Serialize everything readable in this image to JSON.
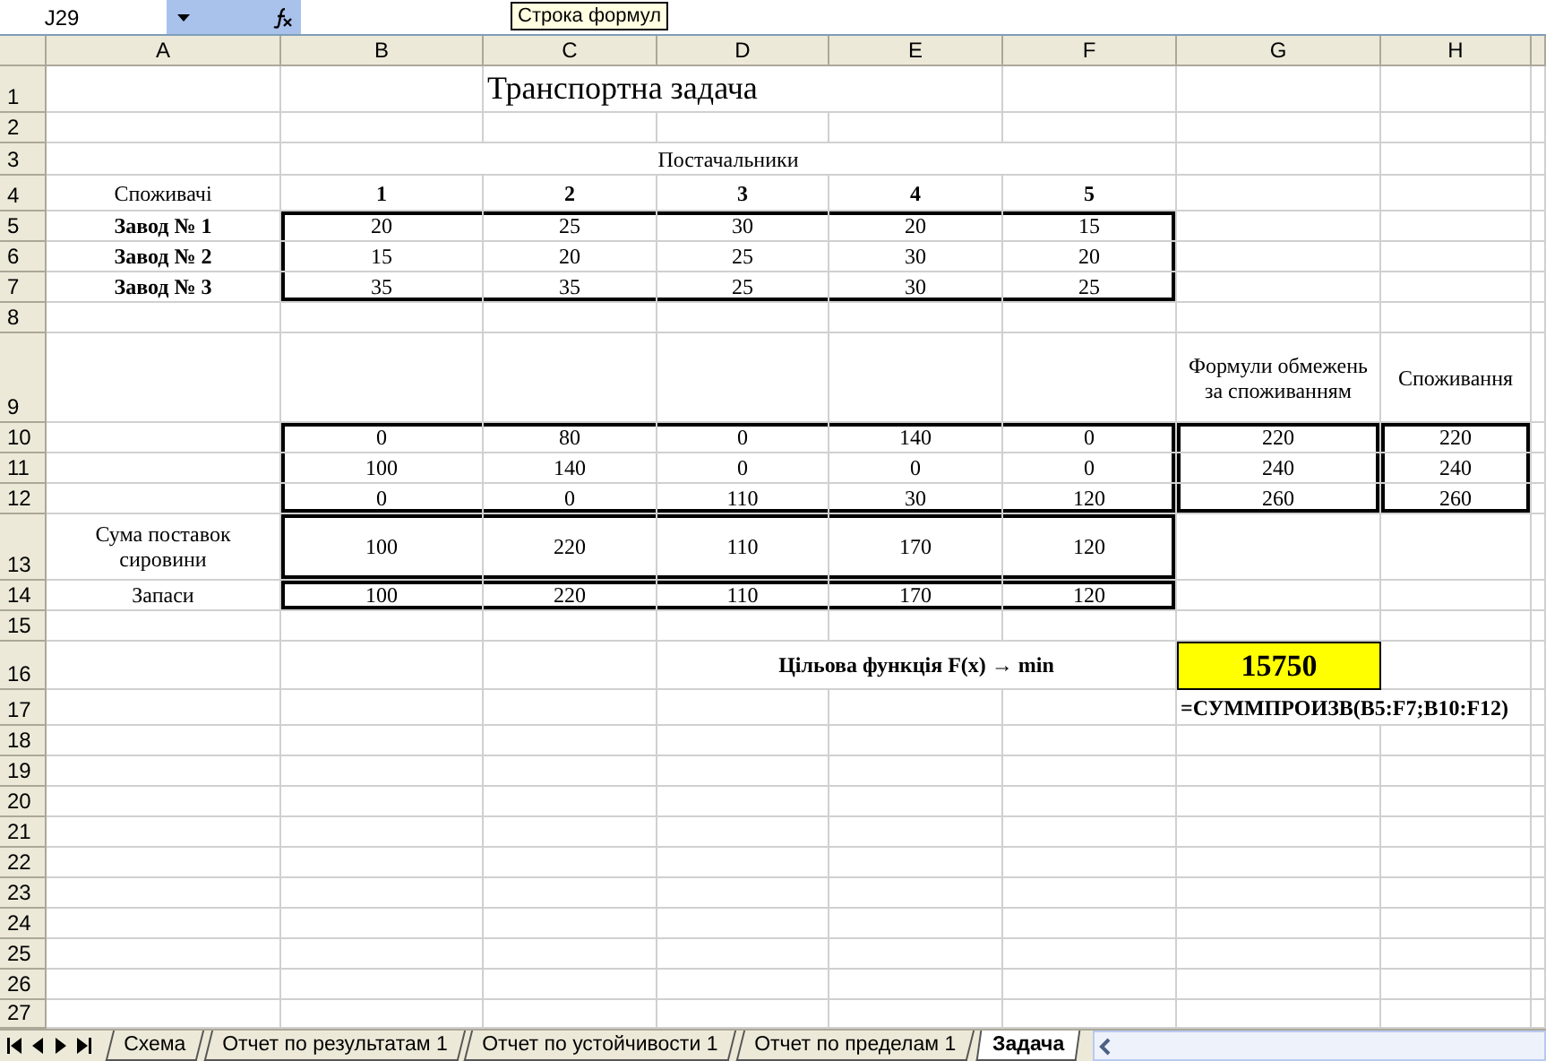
{
  "name_box": {
    "value": "J29"
  },
  "formula_bar": {
    "tooltip": "Строка формул"
  },
  "columns": [
    "A",
    "B",
    "C",
    "D",
    "E",
    "F",
    "G",
    "H"
  ],
  "rows": [
    {
      "number": "1",
      "cells": {
        "C": {
          "text": "Транспортна задача",
          "kind": "title"
        }
      }
    },
    {
      "number": "2",
      "cells": {}
    },
    {
      "number": "3",
      "cells": {
        "B": {
          "text": "Постачальники",
          "kind": "text"
        }
      }
    },
    {
      "number": "4",
      "cells": {
        "A": {
          "text": "Споживачі",
          "kind": "text"
        },
        "B": {
          "text": "1",
          "kind": "bold"
        },
        "C": {
          "text": "2",
          "kind": "bold"
        },
        "D": {
          "text": "3",
          "kind": "bold"
        },
        "E": {
          "text": "4",
          "kind": "bold"
        },
        "F": {
          "text": "5",
          "kind": "bold"
        }
      }
    },
    {
      "number": "5",
      "cells": {
        "A": {
          "text": "Завод № 1",
          "kind": "bold"
        },
        "B": {
          "text": "20",
          "kind": "text"
        },
        "C": {
          "text": "25",
          "kind": "text"
        },
        "D": {
          "text": "30",
          "kind": "text"
        },
        "E": {
          "text": "20",
          "kind": "text"
        },
        "F": {
          "text": "15",
          "kind": "text"
        }
      }
    },
    {
      "number": "6",
      "cells": {
        "A": {
          "text": "Завод № 2",
          "kind": "bold"
        },
        "B": {
          "text": "15",
          "kind": "text"
        },
        "C": {
          "text": "20",
          "kind": "text"
        },
        "D": {
          "text": "25",
          "kind": "text"
        },
        "E": {
          "text": "30",
          "kind": "text"
        },
        "F": {
          "text": "20",
          "kind": "text"
        }
      }
    },
    {
      "number": "7",
      "cells": {
        "A": {
          "text": "Завод № 3",
          "kind": "bold"
        },
        "B": {
          "text": "35",
          "kind": "text"
        },
        "C": {
          "text": "35",
          "kind": "text"
        },
        "D": {
          "text": "25",
          "kind": "text"
        },
        "E": {
          "text": "30",
          "kind": "text"
        },
        "F": {
          "text": "25",
          "kind": "text"
        }
      }
    },
    {
      "number": "8",
      "cells": {}
    },
    {
      "number": "9",
      "cells": {
        "G": {
          "text": "Формули обмежень за споживанням",
          "kind": "text"
        },
        "H": {
          "text": "Споживання",
          "kind": "text"
        }
      }
    },
    {
      "number": "10",
      "cells": {
        "B": {
          "text": "0",
          "kind": "text"
        },
        "C": {
          "text": "80",
          "kind": "text"
        },
        "D": {
          "text": "0",
          "kind": "text"
        },
        "E": {
          "text": "140",
          "kind": "text"
        },
        "F": {
          "text": "0",
          "kind": "text"
        },
        "G": {
          "text": "220",
          "kind": "text"
        },
        "H": {
          "text": "220",
          "kind": "text"
        }
      }
    },
    {
      "number": "11",
      "cells": {
        "B": {
          "text": "100",
          "kind": "text"
        },
        "C": {
          "text": "140",
          "kind": "text"
        },
        "D": {
          "text": "0",
          "kind": "text"
        },
        "E": {
          "text": "0",
          "kind": "text"
        },
        "F": {
          "text": "0",
          "kind": "text"
        },
        "G": {
          "text": "240",
          "kind": "text"
        },
        "H": {
          "text": "240",
          "kind": "text"
        }
      }
    },
    {
      "number": "12",
      "cells": {
        "B": {
          "text": "0",
          "kind": "text"
        },
        "C": {
          "text": "0",
          "kind": "text"
        },
        "D": {
          "text": "110",
          "kind": "text"
        },
        "E": {
          "text": "30",
          "kind": "text"
        },
        "F": {
          "text": "120",
          "kind": "text"
        },
        "G": {
          "text": "260",
          "kind": "text"
        },
        "H": {
          "text": "260",
          "kind": "text"
        }
      }
    },
    {
      "number": "13",
      "cells": {
        "A": {
          "text": "Сума поставок сировини",
          "kind": "text"
        },
        "B": {
          "text": "100",
          "kind": "text"
        },
        "C": {
          "text": "220",
          "kind": "text"
        },
        "D": {
          "text": "110",
          "kind": "text"
        },
        "E": {
          "text": "170",
          "kind": "text"
        },
        "F": {
          "text": "120",
          "kind": "text"
        }
      }
    },
    {
      "number": "14",
      "cells": {
        "A": {
          "text": "Запаси",
          "kind": "text"
        },
        "B": {
          "text": "100",
          "kind": "text"
        },
        "C": {
          "text": "220",
          "kind": "text"
        },
        "D": {
          "text": "110",
          "kind": "text"
        },
        "E": {
          "text": "170",
          "kind": "text"
        },
        "F": {
          "text": "120",
          "kind": "text"
        }
      }
    },
    {
      "number": "15",
      "cells": {}
    },
    {
      "number": "16",
      "cells": {
        "D": {
          "text": "Цільова функція  F(x) →  min",
          "kind": "bold"
        },
        "G": {
          "text": "15750",
          "kind": "result"
        }
      }
    },
    {
      "number": "17",
      "cells": {
        "G": {
          "text": "=СУММПРОИЗВ(B5:F7;B10:F12)",
          "kind": "formula"
        }
      }
    },
    {
      "number": "18",
      "cells": {}
    },
    {
      "number": "19",
      "cells": {}
    },
    {
      "number": "20",
      "cells": {}
    },
    {
      "number": "21",
      "cells": {}
    },
    {
      "number": "22",
      "cells": {}
    },
    {
      "number": "23",
      "cells": {}
    },
    {
      "number": "24",
      "cells": {}
    },
    {
      "number": "25",
      "cells": {}
    },
    {
      "number": "26",
      "cells": {}
    },
    {
      "number": "27",
      "cells": {}
    }
  ],
  "sheet_tabs": [
    {
      "label": "Схема",
      "selected": false
    },
    {
      "label": "Отчет по результатам 1",
      "selected": false
    },
    {
      "label": "Отчет по устойчивости 1",
      "selected": false
    },
    {
      "label": "Отчет по пределам 1",
      "selected": false
    },
    {
      "label": "Задача",
      "selected": true
    }
  ]
}
